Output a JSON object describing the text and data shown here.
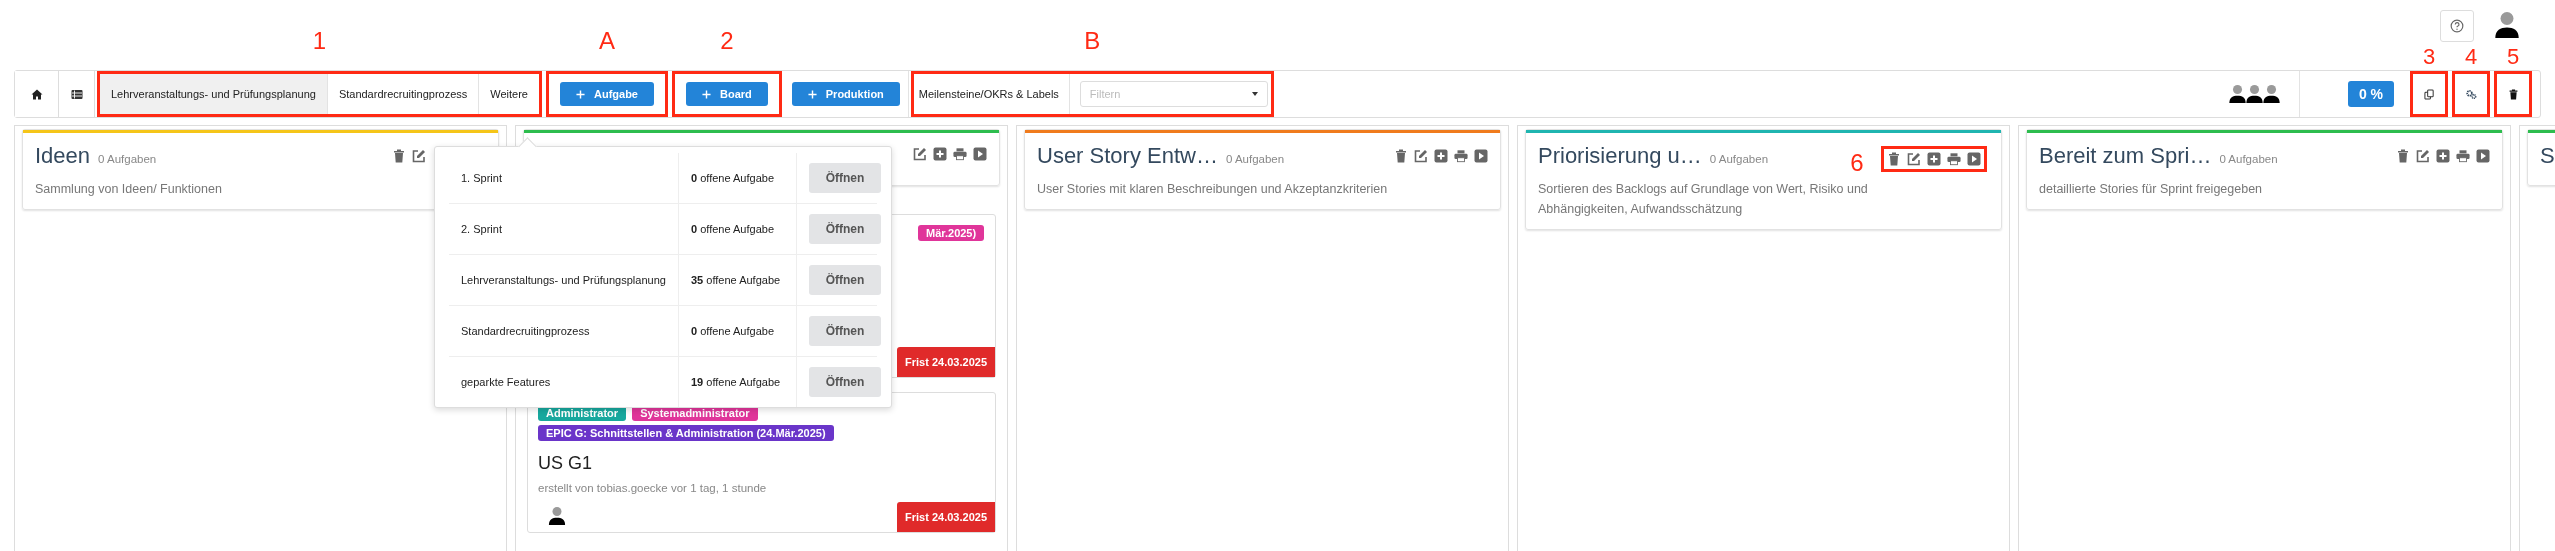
{
  "toolbar": {
    "tabs_callout": "1",
    "tabs": [
      {
        "label": "Lehrveranstaltungs- und Prüfungsplanung",
        "selected": true
      },
      {
        "label": "Standardrecruitingprozess",
        "selected": false
      },
      {
        "label": "Weitere",
        "selected": false
      }
    ],
    "buttons": [
      {
        "label": "Aufgabe",
        "callout": "A"
      },
      {
        "label": "Board",
        "callout": "2"
      },
      {
        "label": "Produktion"
      }
    ],
    "filter": {
      "label": "Meilensteine/OKRs & Labels",
      "placeholder": "Filtern",
      "callout": "B"
    },
    "progress": "0 %",
    "actions": [
      {
        "kind": "copy",
        "callout": "3"
      },
      {
        "kind": "settings",
        "callout": "4"
      },
      {
        "kind": "delete",
        "callout": "5"
      }
    ]
  },
  "board_menu": {
    "rows": [
      {
        "name": "1. Sprint",
        "count": "**0** offene Aufgabe",
        "button": "Öffnen"
      },
      {
        "name": "2. Sprint",
        "count": "**0** offene Aufgabe",
        "button": "Öffnen"
      },
      {
        "name": "Lehrveranstaltungs- und Prüfungsplanung",
        "count": "**35** offene Aufgabe",
        "button": "Öffnen"
      },
      {
        "name": "Standardrecruitingprozess",
        "count": "**0** offene Aufgabe",
        "button": "Öffnen"
      },
      {
        "name": "geparkte Features",
        "count": "**19** offene Aufgabe",
        "button": "Öffnen"
      }
    ]
  },
  "columns": [
    {
      "kind": "covered-right",
      "title": "Ideen",
      "count": "0 Aufgaben",
      "description": "Sammlung von Ideen/ Funktionen",
      "color": "#f5c518"
    },
    {
      "kind": "covered-left",
      "color": "#2dbd4e",
      "cards": [
        {
          "tags": [
            {
              "text": "Mär.2025)",
              "color": "#e0359a"
            }
          ],
          "deadline": "Frist 24.03.2025"
        },
        {
          "tags": [
            {
              "text": "Administrator",
              "color": "#17a89e"
            },
            {
              "text": "Systemadministrator",
              "color": "#e0359a"
            },
            {
              "text": "EPIC G: Schnittstellen & Administration (24.Mär.2025)",
              "color": "#6a35c9"
            }
          ],
          "title": "US G1",
          "meta": "erstellt von tobias.goecke vor 1 tag, 1 stunde",
          "deadline": "Frist 24.03.2025"
        }
      ]
    },
    {
      "kind": "full",
      "title": "User Story Entw…",
      "count": "0 Aufgaben",
      "description": "User Stories mit klaren Beschreibungen und Akzeptanzkriterien",
      "color": "#f07b1d"
    },
    {
      "kind": "full",
      "title": "Priorisierung u…",
      "count": "0 Aufgaben",
      "description": "Sortieren des Backlogs auf Grundlage von Wert, Risiko und Abhängigkeiten, Aufwandsschätzung",
      "color": "#1fb5b0",
      "icons_callout": "6"
    },
    {
      "kind": "full",
      "title": "Bereit zum Spri…",
      "count": "0 Aufgaben",
      "description": "detaillierte Stories für Sprint freigegeben",
      "color": "#2dbd4e"
    },
    {
      "kind": "edge",
      "title": "S",
      "color": "#2dbd4e"
    }
  ]
}
